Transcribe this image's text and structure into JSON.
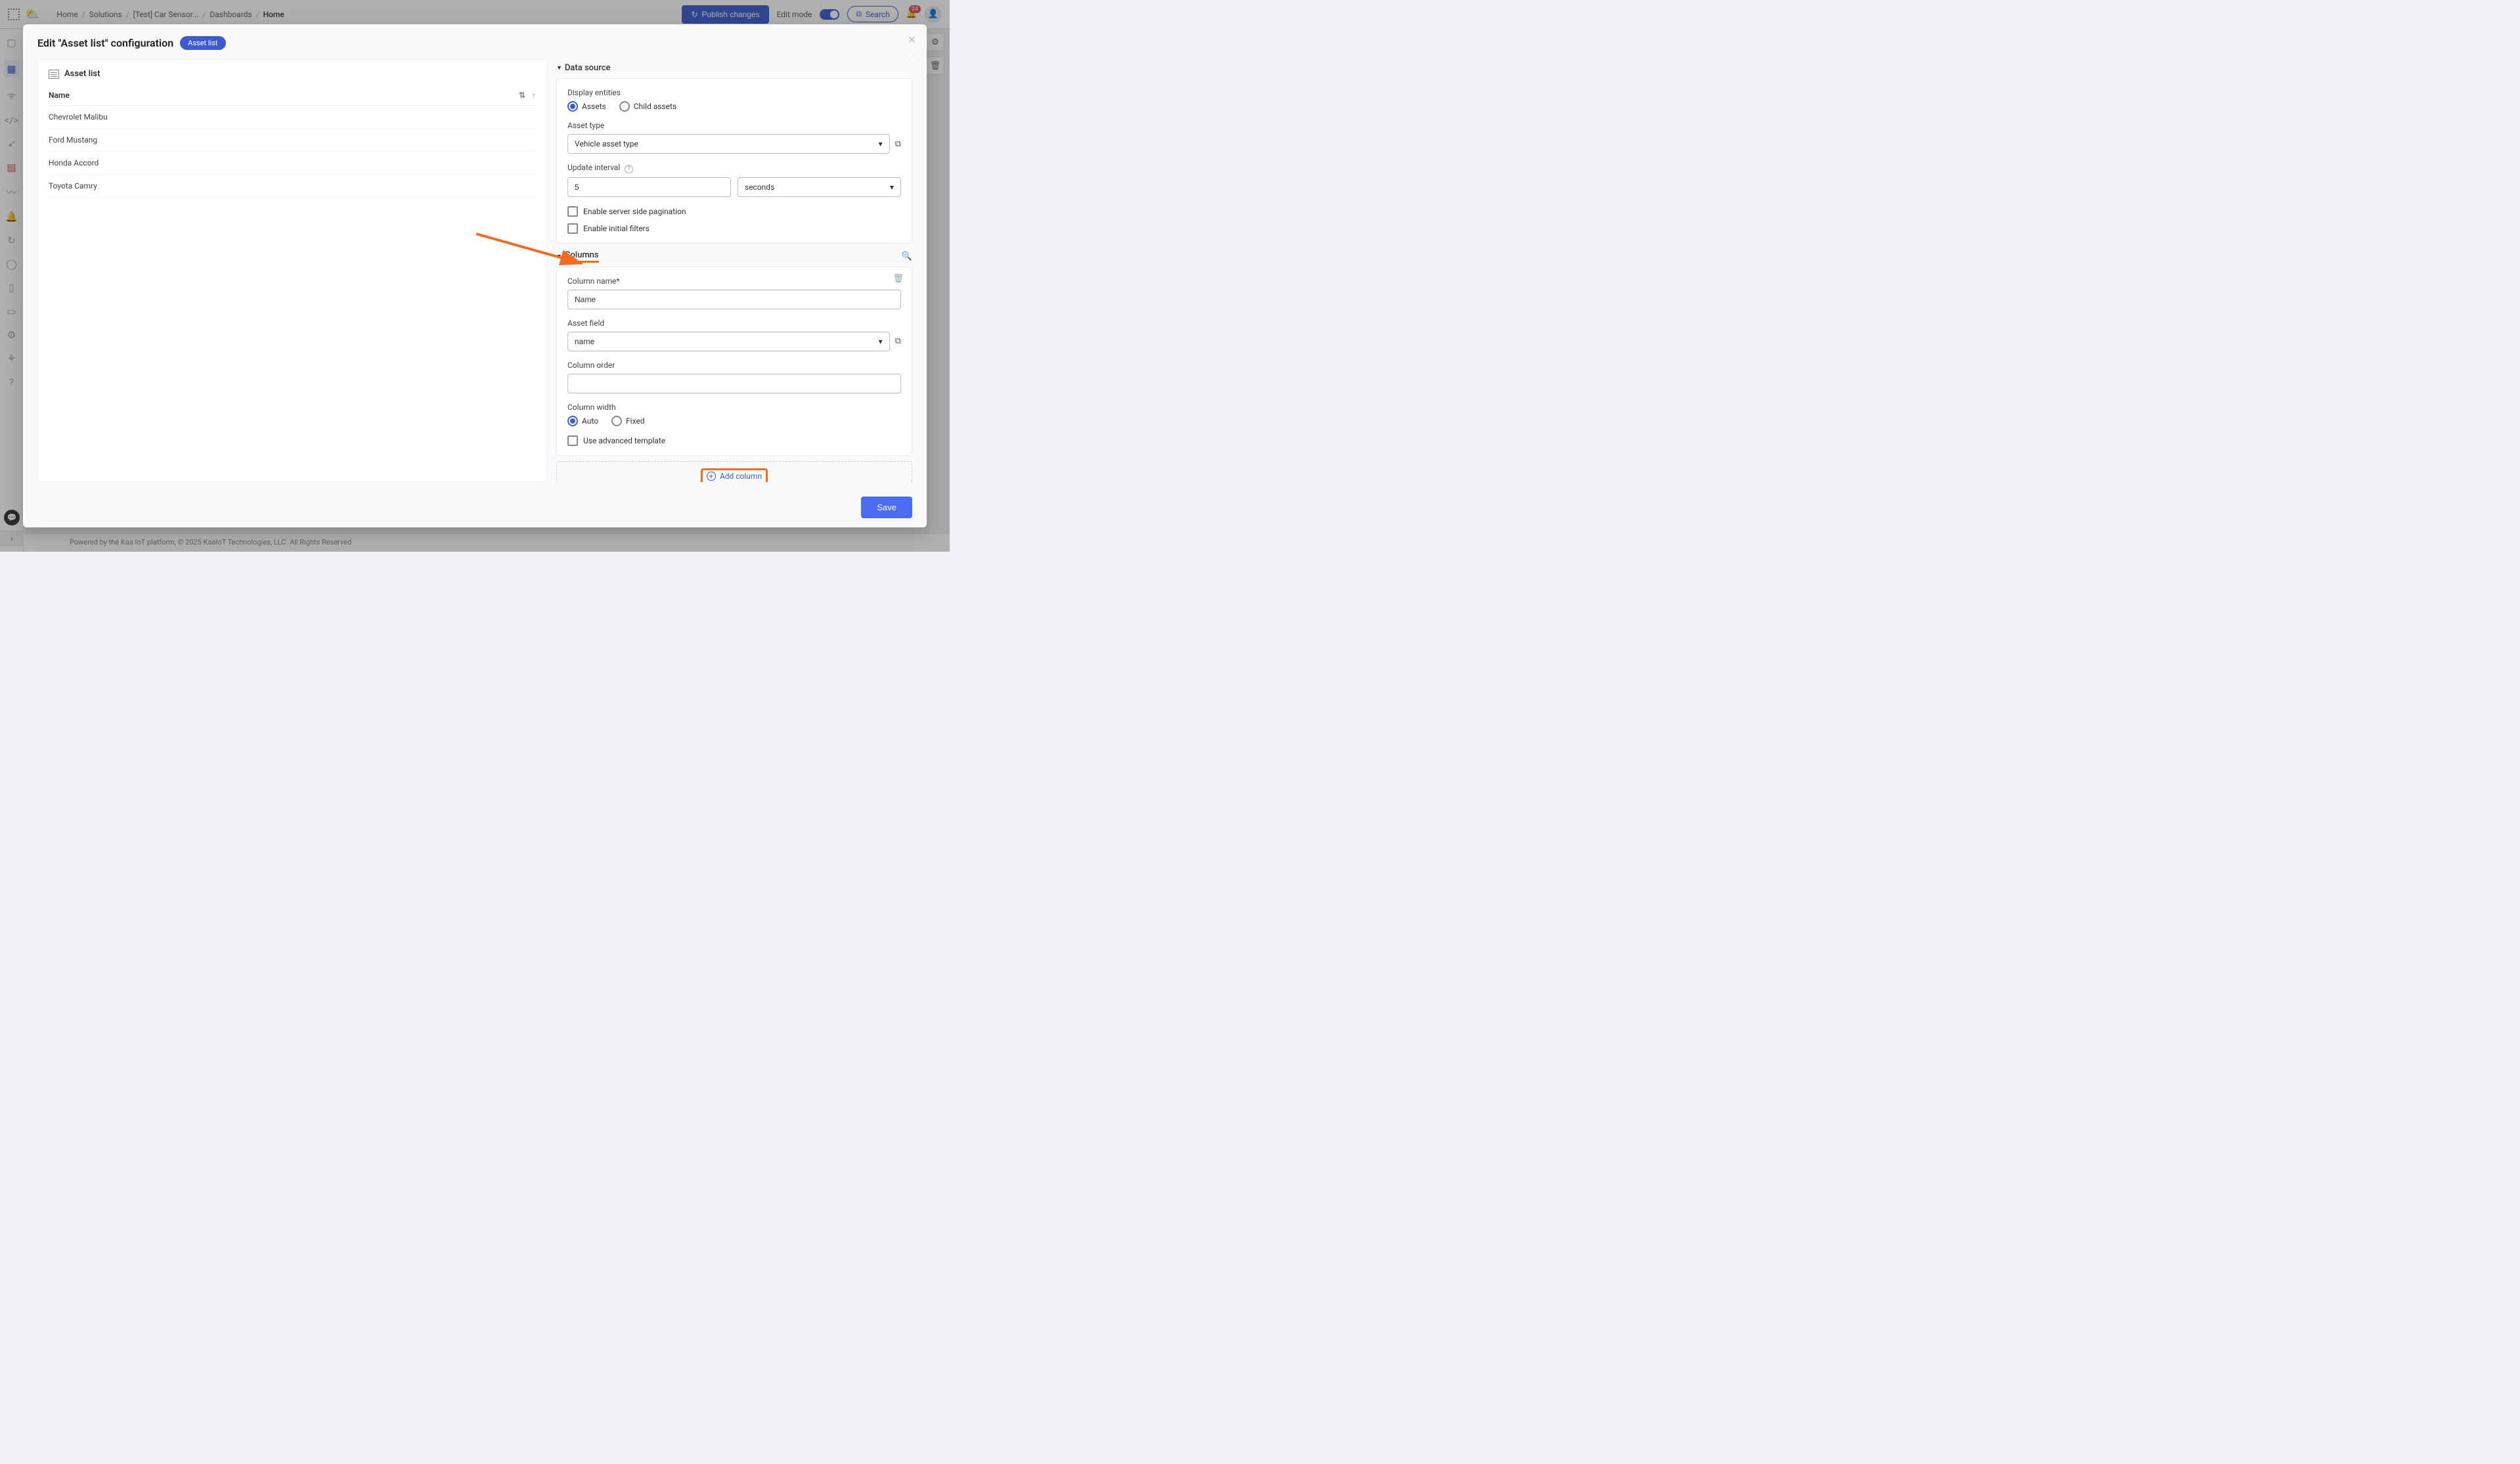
{
  "navbar": {
    "breadcrumb": [
      "Home",
      "Solutions",
      "[Test] Car Sensor...",
      "Dashboards",
      "Home"
    ],
    "publish_button": "Publish changes",
    "edit_mode_label": "Edit mode",
    "search_label": "Search",
    "notification_count": "24"
  },
  "footer": {
    "text": "Powered by the Kaa IoT platform, © 2025 KaaIoT Technologies, LLC. All Rights Reserved"
  },
  "modal": {
    "title": "Edit \"Asset list\" configuration",
    "badge": "Asset list",
    "save_button": "Save"
  },
  "preview": {
    "widget_title": "Asset list",
    "column_header": "Name",
    "rows": [
      "Chevrolet Malibu",
      "Ford Mustang",
      "Honda Accord",
      "Toyota Camry"
    ]
  },
  "config": {
    "data_source_label": "Data source",
    "display_entities_label": "Display entities",
    "assets_radio": "Assets",
    "child_assets_radio": "Child assets",
    "asset_type_label": "Asset type",
    "asset_type_value": "Vehicle asset type",
    "update_interval_label": "Update interval",
    "update_interval_value": "5",
    "update_interval_unit": "seconds",
    "enable_server_side": "Enable server side pagination",
    "enable_initial_filters": "Enable initial filters",
    "columns_label": "Columns",
    "column_name_label": "Column name*",
    "column_name_value": "Name",
    "asset_field_label": "Asset field",
    "asset_field_value": "name",
    "column_order_label": "Column order",
    "column_order_value": "",
    "column_width_label": "Column width",
    "width_auto": "Auto",
    "width_fixed": "Fixed",
    "use_advanced_template": "Use advanced template",
    "add_column_label": "Add column"
  }
}
